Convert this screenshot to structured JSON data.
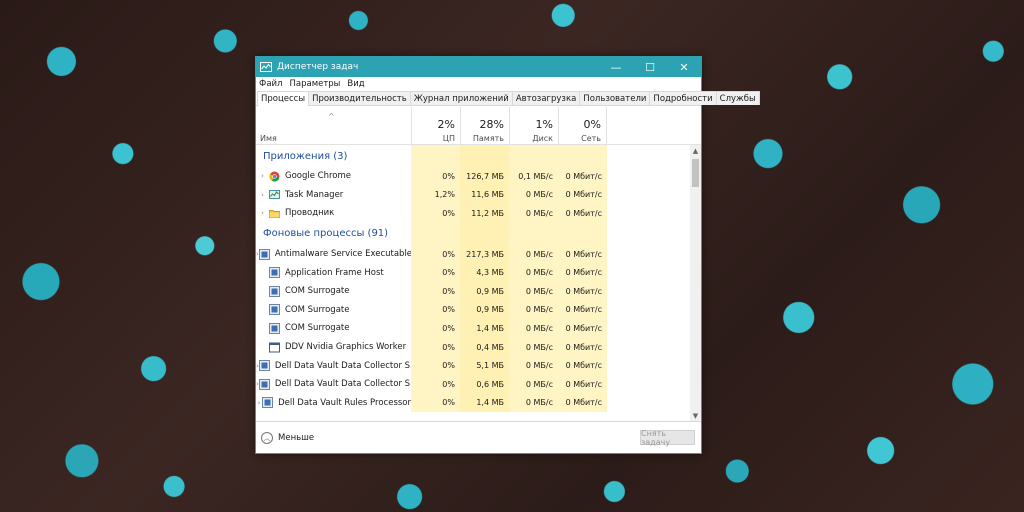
{
  "window": {
    "title": "Диспетчер задач",
    "minimize": "—",
    "maximize": "☐",
    "close": "✕"
  },
  "menu": [
    "Файл",
    "Параметры",
    "Вид"
  ],
  "tabs": [
    "Процессы",
    "Производительность",
    "Журнал приложений",
    "Автозагрузка",
    "Пользователи",
    "Подробности",
    "Службы"
  ],
  "header": {
    "name": "Имя",
    "cpu_pct": "2%",
    "cpu_label": "ЦП",
    "mem_pct": "28%",
    "mem_label": "Память",
    "disk_pct": "1%",
    "disk_label": "Диск",
    "net_pct": "0%",
    "net_label": "Сеть"
  },
  "groups": {
    "apps": "Приложения (3)",
    "background": "Фоновые процессы (91)"
  },
  "apps": [
    {
      "name": "Google Chrome",
      "icon": "chrome-icon",
      "expandable": true,
      "cpu": "0%",
      "mem": "126,7 МБ",
      "disk": "0,1 МБ/с",
      "net": "0 Мбит/с"
    },
    {
      "name": "Task Manager",
      "icon": "task-manager-icon",
      "expandable": true,
      "cpu": "1,2%",
      "mem": "11,6 МБ",
      "disk": "0 МБ/с",
      "net": "0 Мбит/с"
    },
    {
      "name": "Проводник",
      "icon": "folder-icon",
      "expandable": true,
      "cpu": "0%",
      "mem": "11,2 МБ",
      "disk": "0 МБ/с",
      "net": "0 Мбит/с"
    }
  ],
  "background": [
    {
      "name": "Antimalware Service Executable",
      "icon": "service-icon",
      "expandable": true,
      "cpu": "0%",
      "mem": "217,3 МБ",
      "disk": "0 МБ/с",
      "net": "0 Мбит/с"
    },
    {
      "name": "Application Frame Host",
      "icon": "service-icon",
      "expandable": false,
      "cpu": "0%",
      "mem": "4,3 МБ",
      "disk": "0 МБ/с",
      "net": "0 Мбит/с"
    },
    {
      "name": "COM Surrogate",
      "icon": "service-icon",
      "expandable": false,
      "cpu": "0%",
      "mem": "0,9 МБ",
      "disk": "0 МБ/с",
      "net": "0 Мбит/с"
    },
    {
      "name": "COM Surrogate",
      "icon": "service-icon",
      "expandable": false,
      "cpu": "0%",
      "mem": "0,9 МБ",
      "disk": "0 МБ/с",
      "net": "0 Мбит/с"
    },
    {
      "name": "COM Surrogate",
      "icon": "service-icon",
      "expandable": false,
      "cpu": "0%",
      "mem": "1,4 МБ",
      "disk": "0 МБ/с",
      "net": "0 Мбит/с"
    },
    {
      "name": "DDV Nvidia Graphics Worker",
      "icon": "window-icon",
      "expandable": false,
      "cpu": "0%",
      "mem": "0,4 МБ",
      "disk": "0 МБ/с",
      "net": "0 Мбит/с"
    },
    {
      "name": "Dell Data Vault Data Collector S...",
      "icon": "service-icon",
      "expandable": true,
      "cpu": "0%",
      "mem": "5,1 МБ",
      "disk": "0 МБ/с",
      "net": "0 Мбит/с"
    },
    {
      "name": "Dell Data Vault Data Collector S...",
      "icon": "service-icon",
      "expandable": true,
      "cpu": "0%",
      "mem": "0,6 МБ",
      "disk": "0 МБ/с",
      "net": "0 Мбит/с"
    },
    {
      "name": "Dell Data Vault Rules Processor",
      "icon": "service-icon",
      "expandable": true,
      "cpu": "0%",
      "mem": "1,4 МБ",
      "disk": "0 МБ/с",
      "net": "0 Мбит/с"
    }
  ],
  "footer": {
    "fewer_details": "Меньше",
    "end_task": "Снять задачу"
  }
}
